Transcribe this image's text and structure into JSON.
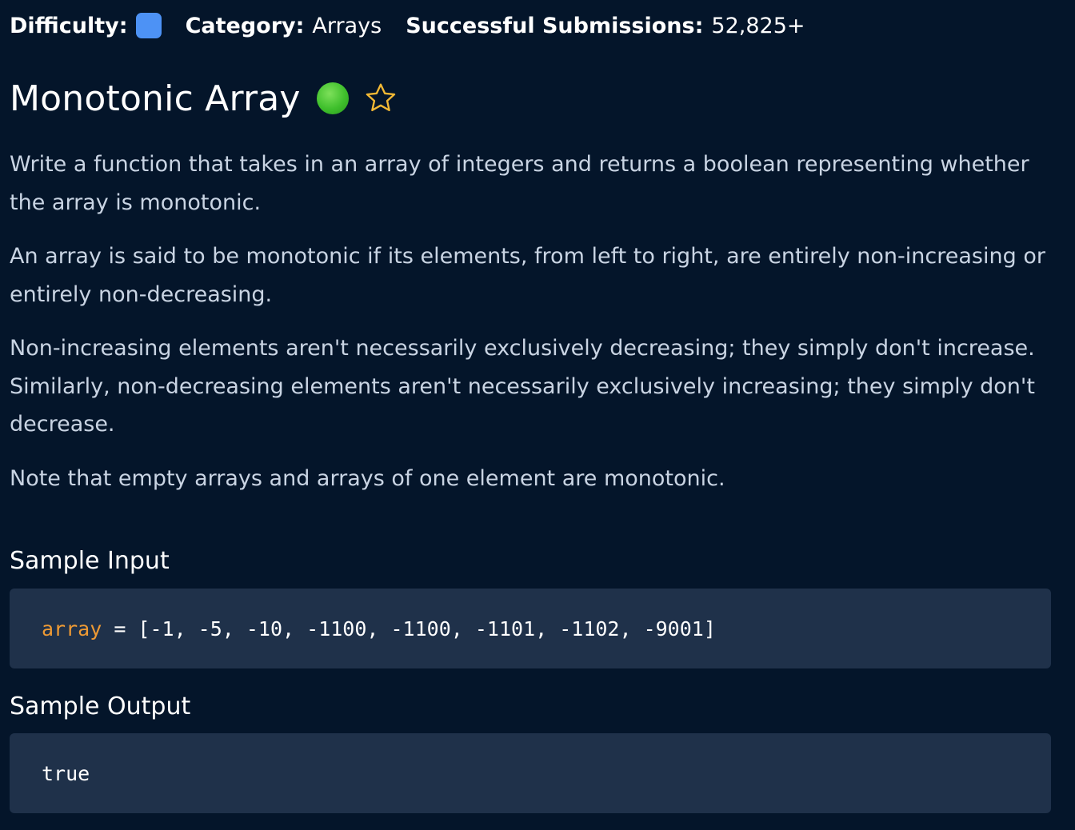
{
  "meta": {
    "difficulty_label": "Difficulty:",
    "category_label": "Category:",
    "category_value": "Arrays",
    "submissions_label": "Successful Submissions:",
    "submissions_value": "52,825+",
    "difficulty_color": "#4d92f5"
  },
  "title": "Monotonic Array",
  "status_color": "#3fbf2c",
  "star_color": "#f2b834",
  "description": [
    "Write a function that takes in an array of integers and returns a boolean representing whether the array is monotonic.",
    "An array is said to be monotonic if its elements, from left to right, are entirely non-increasing or entirely non-decreasing.",
    "Non-increasing elements aren't necessarily exclusively decreasing; they simply don't increase. Similarly, non-decreasing elements aren't necessarily exclusively increasing; they simply don't decrease.",
    "Note that empty arrays and arrays of one element are monotonic."
  ],
  "sample_input": {
    "heading": "Sample Input",
    "var_name": "array",
    "assign": " = ",
    "value": "[-1, -5, -10, -1100, -1100, -1101, -1102, -9001]"
  },
  "sample_output": {
    "heading": "Sample Output",
    "value": "true"
  }
}
